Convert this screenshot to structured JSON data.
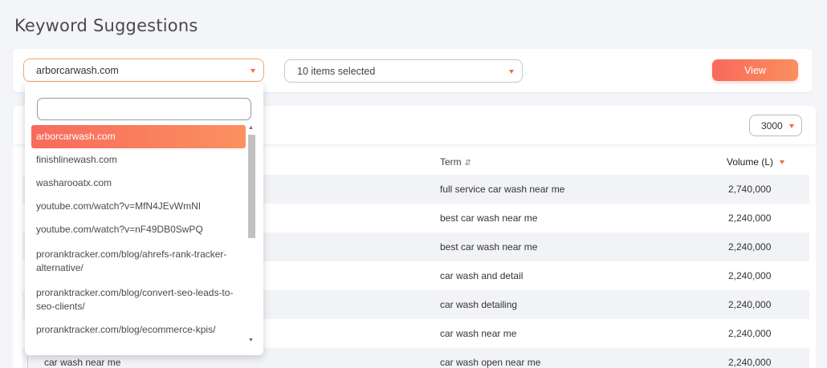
{
  "page": {
    "title": "Keyword Suggestions"
  },
  "filters": {
    "domain_value": "arborcarwash.com",
    "items_value": "10 items selected",
    "view_label": "View"
  },
  "table": {
    "limit_value": "3000",
    "headers": {
      "term": "Term",
      "volume": "Volume (L)"
    },
    "rows": [
      {
        "keyword": "",
        "term": "full service car wash near me",
        "volume": "2,740,000"
      },
      {
        "keyword": "",
        "term": "best car wash near me",
        "volume": "2,240,000"
      },
      {
        "keyword": "",
        "term": "best car wash near me",
        "volume": "2,240,000"
      },
      {
        "keyword": "",
        "term": "car wash and detail",
        "volume": "2,240,000"
      },
      {
        "keyword": "",
        "term": "car wash detailing",
        "volume": "2,240,000"
      },
      {
        "keyword": "",
        "term": "car wash near me",
        "volume": "2,240,000"
      },
      {
        "keyword": "car wash near me",
        "term": "car wash open near me",
        "volume": "2,240,000"
      }
    ]
  },
  "dropdown": {
    "search_value": "",
    "options": [
      {
        "label": "arborcarwash.com",
        "selected": true
      },
      {
        "label": "finishlinewash.com",
        "selected": false
      },
      {
        "label": "washarooatx.com",
        "selected": false
      },
      {
        "label": "youtube.com/watch?v=MfN4JEvWmNI",
        "selected": false
      },
      {
        "label": "youtube.com/watch?v=nF49DB0SwPQ",
        "selected": false
      },
      {
        "label": "proranktracker.com/blog/ahrefs-rank-tracker-alternative/",
        "selected": false
      },
      {
        "label": "proranktracker.com/blog/convert-seo-leads-to-seo-clients/",
        "selected": false
      },
      {
        "label": "proranktracker.com/blog/ecommerce-kpis/",
        "selected": false
      }
    ]
  },
  "colors": {
    "accent": "#f86a5d",
    "accent_light": "#fb8f5f",
    "focus_border": "#f3a76a"
  }
}
